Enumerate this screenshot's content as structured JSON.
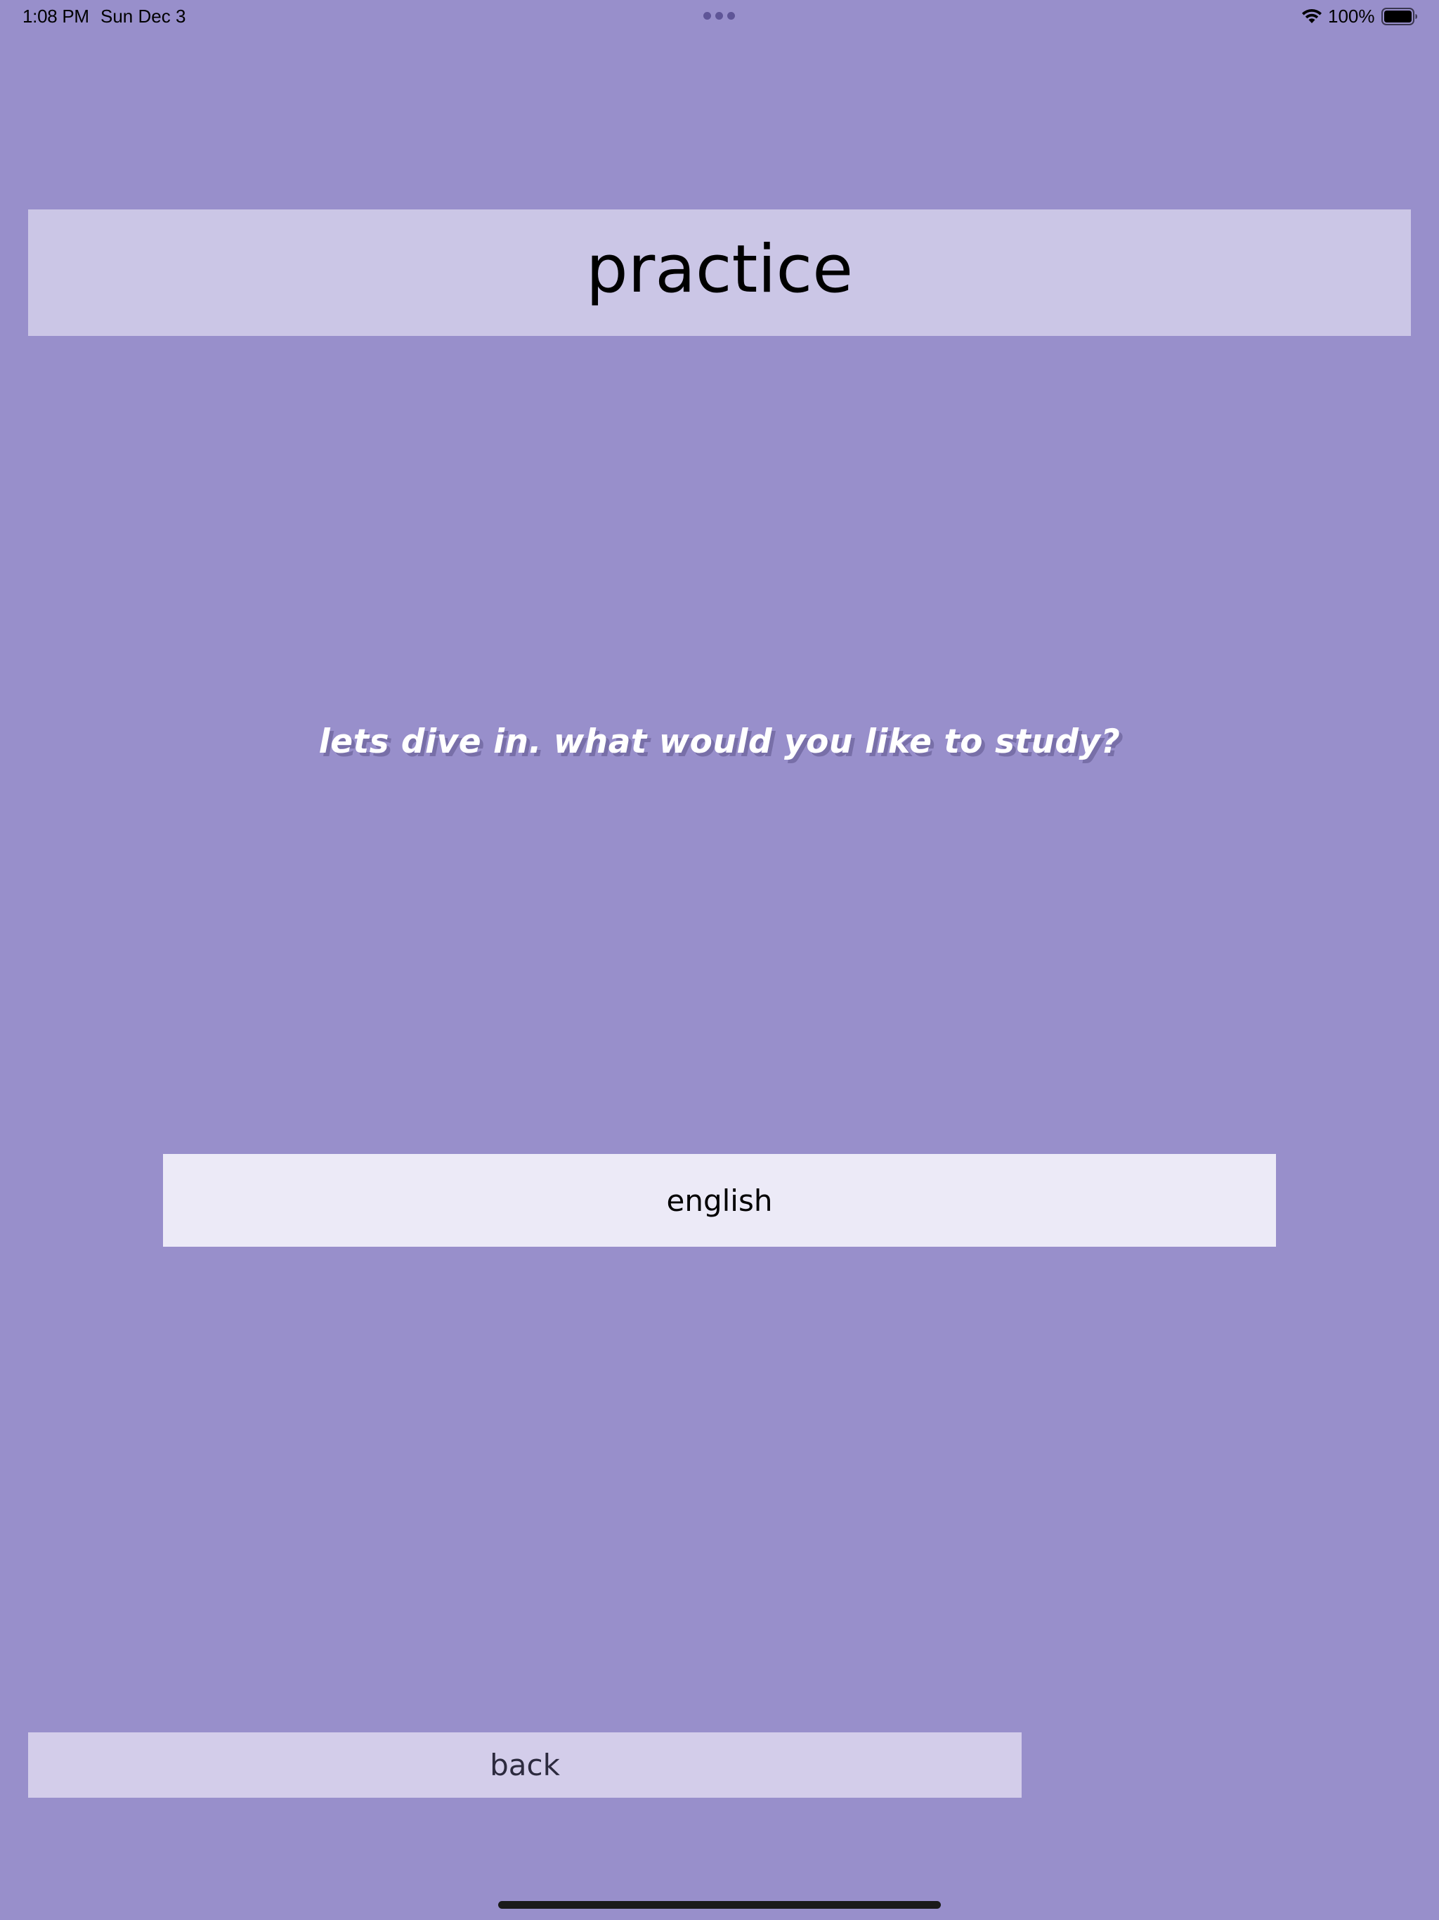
{
  "status_bar": {
    "time": "1:08 PM",
    "date": "Sun Dec 3",
    "battery_percent": "100%",
    "battery_level": 1.0,
    "icons": [
      "multitask-dots-icon",
      "wifi-icon",
      "battery-icon"
    ]
  },
  "header": {
    "title": "practice"
  },
  "prompt": {
    "text": "lets dive in. what would you like to study?"
  },
  "subjects": [
    {
      "label": "english"
    }
  ],
  "navigation": {
    "back_label": "back"
  },
  "colors": {
    "background": "#988fcb",
    "header_bg": "#cbc6e6",
    "subject_button_bg": "#eceaf7",
    "back_button_bg": "#d3cdea",
    "prompt_text": "#ffffff"
  }
}
